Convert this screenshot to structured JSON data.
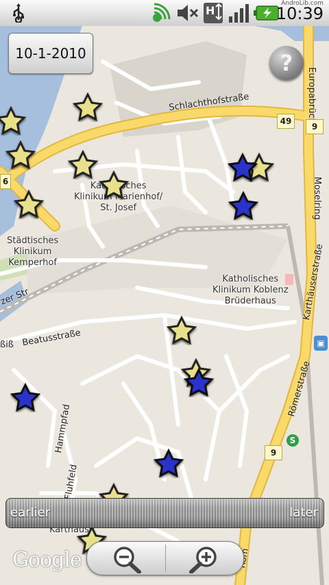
{
  "status_bar": {
    "time": "10:39",
    "watermark": "AndroLib.com",
    "icons": [
      "usb-icon",
      "sync-icon",
      "mute-icon",
      "data-icon",
      "signal-icon",
      "battery-icon"
    ]
  },
  "date_button": {
    "label": "10-1-2010"
  },
  "help_button": {
    "label": "?"
  },
  "slider": {
    "left_label": "earlier",
    "right_label": "later"
  },
  "zoom": {
    "out_icon": "zoom-out-icon",
    "in_icon": "zoom-in-icon"
  },
  "map": {
    "attribution": "Google",
    "labels": {
      "hospital_marienhof": [
        "Katholisches",
        "Klinikum Marienhof/",
        "St. Josef"
      ],
      "hospital_kemperhof": [
        "Städtisches",
        "Klinikum",
        "Kemperhof"
      ],
      "hospital_bruederhaus": [
        "Katholisches",
        "Klinikum Koblenz",
        "Brüderhaus"
      ],
      "karthause": "Karthause"
    },
    "roads": {
      "schlachthof": "Schlachthofstraße",
      "europabruecke": "Europabrücke",
      "moselring": "Moselring",
      "karthauser": "Karthäuserstraße",
      "roemer": "Römerstraße",
      "beatus": "Beatusstraße",
      "hammpfad": "Hammpfad",
      "fluhfeld": "Fluhfeld",
      "zer_str": "zer Str",
      "biss": "ßiß",
      "roem_bottom": "Röm"
    },
    "shields": {
      "b49": "49",
      "b9_top": "9",
      "b9_bottom": "9",
      "b6": "6"
    },
    "colors": {
      "water": "#a5bfdd",
      "major_road": "#fad96b",
      "road": "#ffffff",
      "land": "#ebe7df"
    }
  }
}
